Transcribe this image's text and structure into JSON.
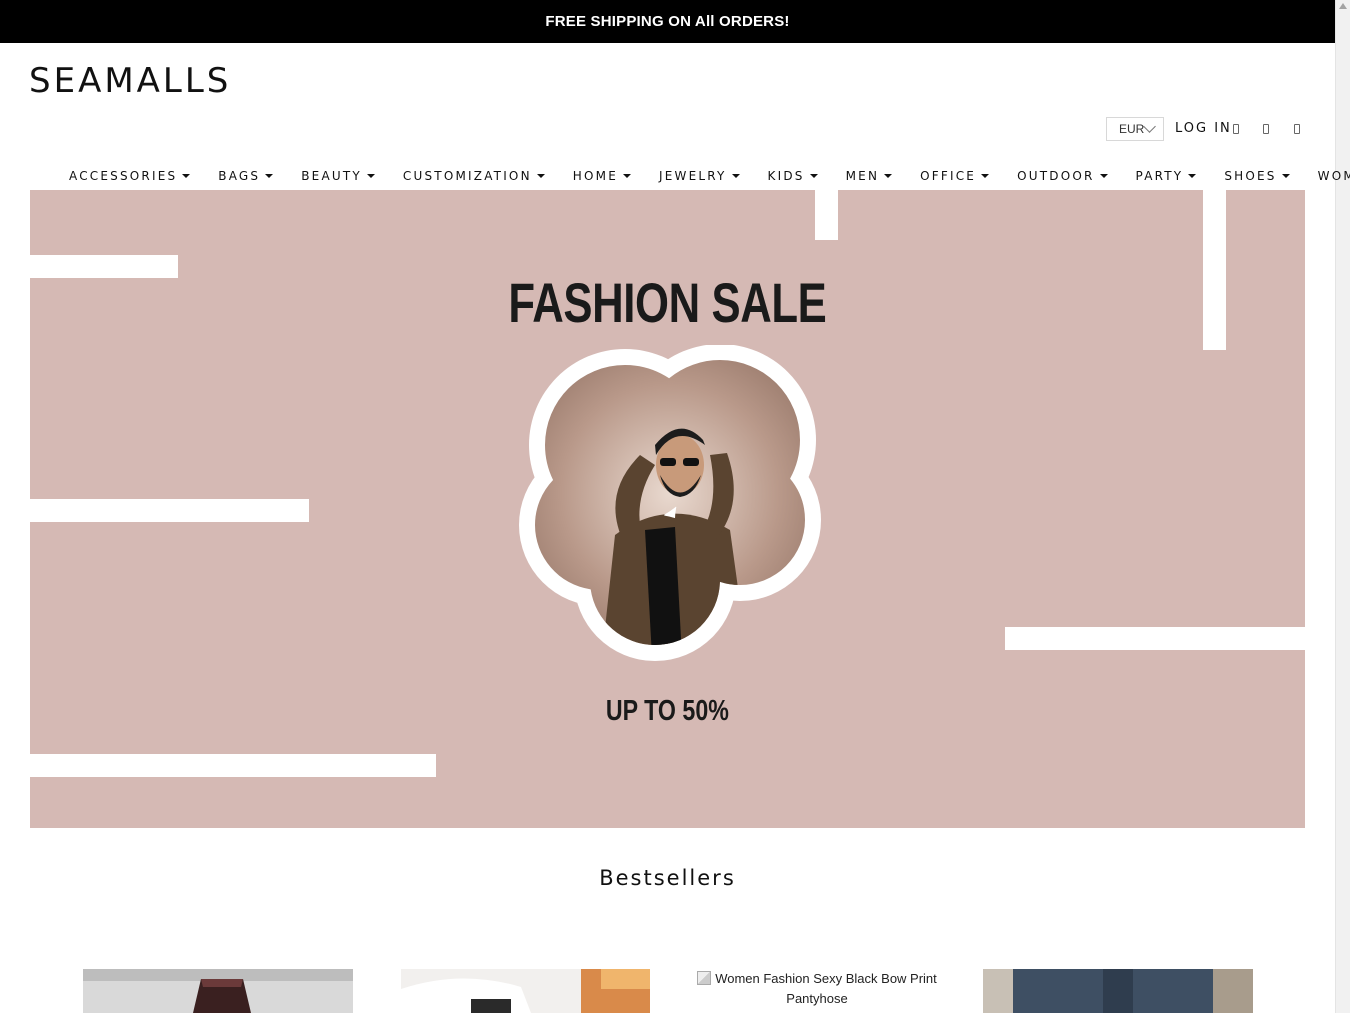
{
  "announcement": {
    "text": "FREE SHIPPING ON All ORDERS!"
  },
  "brand": {
    "logo": "SEAMALLS"
  },
  "header": {
    "currency": "EUR",
    "login_label": "LOG IN",
    "icons": [
      "search-icon",
      "user-icon",
      "cart-icon"
    ]
  },
  "nav": {
    "items": [
      {
        "label": "ACCESSORIES"
      },
      {
        "label": "BAGS"
      },
      {
        "label": "BEAUTY"
      },
      {
        "label": "CUSTOMIZATION"
      },
      {
        "label": "HOME"
      },
      {
        "label": "JEWELRY"
      },
      {
        "label": "KIDS"
      },
      {
        "label": "MEN"
      },
      {
        "label": "OFFICE"
      },
      {
        "label": "OUTDOOR"
      },
      {
        "label": "PARTY"
      },
      {
        "label": "SHOES"
      },
      {
        "label": "WOMEN"
      }
    ]
  },
  "hero": {
    "title": "FASHION SALE",
    "subtitle": "UP TO 50%",
    "background": "#d5b9b4"
  },
  "bestsellers": {
    "title": "Bestsellers",
    "products": [
      {
        "alt": ""
      },
      {
        "alt": ""
      },
      {
        "alt": "Women Fashion Sexy Black Bow Print Pantyhose"
      },
      {
        "alt": ""
      }
    ]
  }
}
